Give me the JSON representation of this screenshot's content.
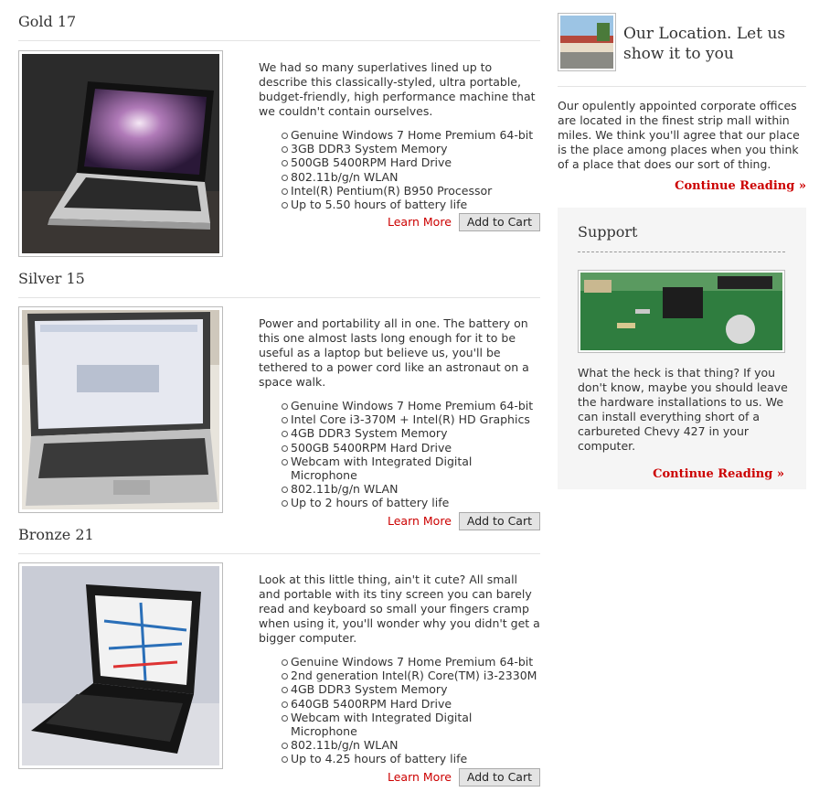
{
  "products": [
    {
      "title": "Gold 17",
      "description": "We had so many superlatives lined up to describe this classically-styled, ultra portable, budget-friendly, high performance machine that we couldn't contain ourselves.",
      "features": [
        "Genuine Windows 7 Home Premium 64-bit",
        "3GB DDR3 System Memory",
        "500GB 5400RPM Hard Drive",
        "802.11b/g/n WLAN",
        "Intel(R) Pentium(R) B950 Processor",
        "Up to 5.50 hours of battery life"
      ],
      "learn_more": "Learn More",
      "add_to_cart": "Add to Cart"
    },
    {
      "title": "Silver 15",
      "description": "Power and portability all in one. The battery on this one almost lasts long enough for it to be useful as a laptop but believe us, you'll be tethered to a power cord like an astronaut on a space walk.",
      "features": [
        "Genuine Windows 7 Home Premium 64-bit",
        "Intel Core i3-370M + Intel(R) HD Graphics",
        "4GB DDR3 System Memory",
        "500GB 5400RPM Hard Drive",
        "Webcam with Integrated Digital Microphone",
        "802.11b/g/n WLAN",
        "Up to 2 hours of battery life"
      ],
      "learn_more": "Learn More",
      "add_to_cart": "Add to Cart"
    },
    {
      "title": "Bronze 21",
      "description": "Look at this little thing, ain't it cute? All small and portable with its tiny screen you can barely read and keyboard so small your fingers cramp when using it, you'll wonder why you didn't get a bigger computer.",
      "features": [
        "Genuine Windows 7 Home Premium 64-bit",
        "2nd generation Intel(R) Core(TM) i3-2330M",
        "4GB DDR3 System Memory",
        "640GB 5400RPM Hard Drive",
        "Webcam with Integrated Digital Microphone",
        "802.11b/g/n WLAN",
        "Up to 4.25 hours of battery life"
      ],
      "learn_more": "Learn More",
      "add_to_cart": "Add to Cart"
    }
  ],
  "sidebar": {
    "location": {
      "title": "Our Location. Let us show it to you",
      "text": "Our opulently appointed corporate offices are located in the finest strip mall within miles. We think you'll agree that our place is the place among places when you think of a place that does our sort of thing.",
      "continue": "Continue Reading »"
    },
    "support": {
      "title": "Support",
      "text": "What the heck is that thing? If you don't know, maybe you should leave the hardware installations to us. We can install everything short of a carbureted Chevy 427 in your computer.",
      "continue": "Continue Reading »"
    }
  },
  "colors": {
    "link": "#cc0000",
    "panel": "#f5f5f5",
    "rule": "#e3e3e3"
  }
}
